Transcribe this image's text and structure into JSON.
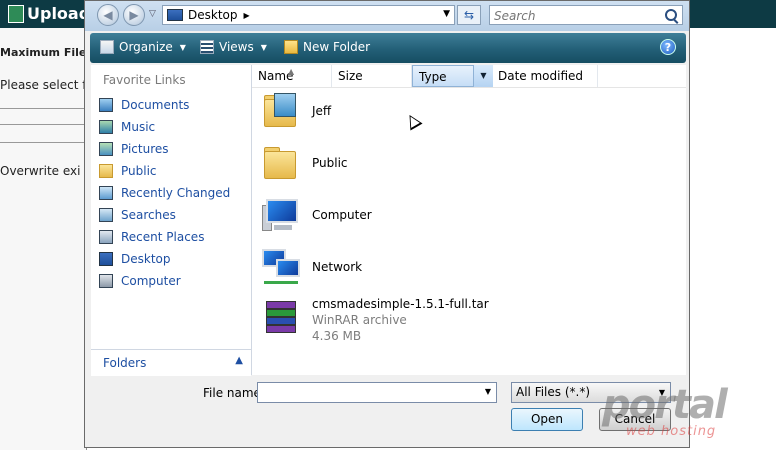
{
  "background_page": {
    "title": "Upload",
    "lines": [
      "Maximum File",
      "Please select fi",
      "Overwrite exi"
    ]
  },
  "dialog": {
    "address": {
      "location": "Desktop"
    },
    "search": {
      "placeholder": "Search"
    },
    "toolbar": {
      "organize_label": "Organize",
      "views_label": "Views",
      "new_folder_label": "New Folder",
      "help_label": "?"
    },
    "nav": {
      "header": "Favorite Links",
      "items": [
        {
          "label": "Documents",
          "icon": "documents-icon"
        },
        {
          "label": "Music",
          "icon": "music-icon"
        },
        {
          "label": "Pictures",
          "icon": "pictures-icon"
        },
        {
          "label": "Public",
          "icon": "public-folder-icon"
        },
        {
          "label": "Recently Changed",
          "icon": "recently-changed-icon"
        },
        {
          "label": "Searches",
          "icon": "searches-icon"
        },
        {
          "label": "Recent Places",
          "icon": "recent-places-icon"
        },
        {
          "label": "Desktop",
          "icon": "desktop-icon"
        },
        {
          "label": "Computer",
          "icon": "computer-icon"
        }
      ],
      "folders_label": "Folders"
    },
    "columns": [
      "Name",
      "Size",
      "Type",
      "Date modified"
    ],
    "files": [
      {
        "name": "Jeff",
        "icon": "user-folder-icon"
      },
      {
        "name": "Public",
        "icon": "folder-icon"
      },
      {
        "name": "Computer",
        "icon": "computer-icon"
      },
      {
        "name": "Network",
        "icon": "network-icon"
      },
      {
        "name": "cmsmadesimple-1.5.1-full.tar",
        "type": "WinRAR archive",
        "size": "4.36 MB",
        "icon": "winrar-archive-icon"
      }
    ],
    "file_name": {
      "label": "File name:",
      "value": ""
    },
    "file_type": {
      "selected": "All Files (*.*)"
    },
    "buttons": {
      "open": "Open",
      "cancel": "Cancel"
    }
  },
  "watermark": {
    "title": "portal",
    "subtitle": "web hosting"
  }
}
